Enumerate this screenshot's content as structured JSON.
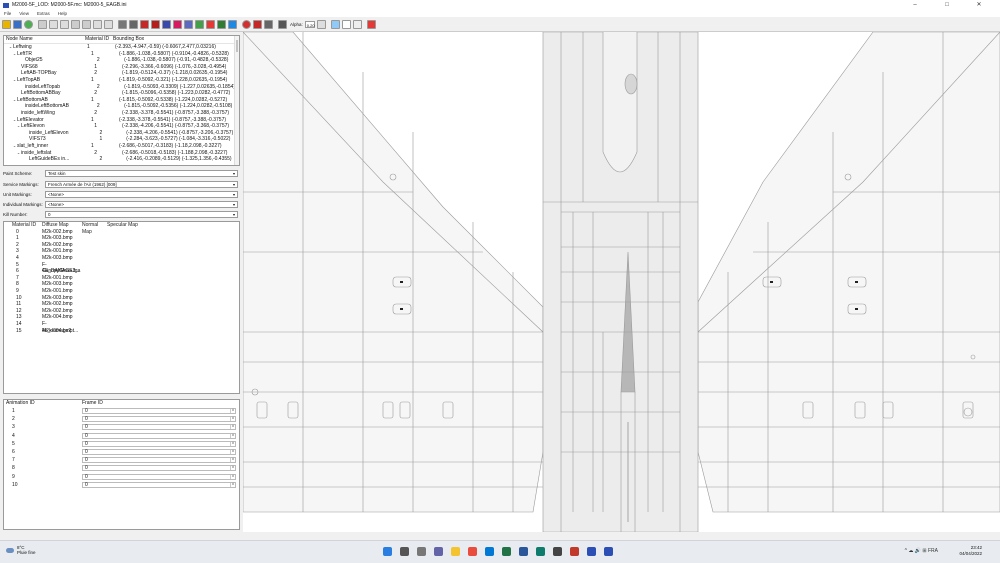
{
  "window": {
    "title": "M2000-5F_LOD: M2000-5F.mc: M2000-5_EAGB.ini",
    "minimize": "–",
    "maximize": "□",
    "close": "✕"
  },
  "menu": [
    "File",
    "View",
    "Extras",
    "Help"
  ],
  "toolbar": {
    "alpha_label": "Alpha:",
    "alpha_value": "0.20"
  },
  "tree": {
    "headers": [
      "Node Name",
      "Material ID",
      "Bounding Box"
    ],
    "rows": [
      {
        "name": "Leftwing",
        "indent": 1,
        "expand": "v",
        "mat": "1",
        "bb": "(-2.393,-4.947,-0.59) (-0.6067,2.477,0.03216)"
      },
      {
        "name": "LeftTR",
        "indent": 2,
        "expand": "v",
        "mat": "1",
        "bb": "(-1.886,-1.038,-0.5807) (-0.9104,-0.4826,-0.5328)"
      },
      {
        "name": "Objet25",
        "indent": 4,
        "expand": "",
        "mat": "2",
        "bb": "(-1.886,-1.038,-0.5807) (-0.91,-0.4828,-0.5328)"
      },
      {
        "name": "VIFS68",
        "indent": 3,
        "expand": "",
        "mat": "1",
        "bb": "(-2.296,-3.366,-0.6096) (-1.076,-3.028,-0.4954)"
      },
      {
        "name": "LeftAB-TOPBay",
        "indent": 3,
        "expand": "",
        "mat": "2",
        "bb": "(-1.819,-0.5124,-0.37) (-1.218,0.02635,-0.1954)"
      },
      {
        "name": "LeftTopAB",
        "indent": 2,
        "expand": "v",
        "mat": "1",
        "bb": "(-1.819,-0.5092,-0.321) (-1.228,0.02635,-0.1954)"
      },
      {
        "name": "insideLeftTopab",
        "indent": 4,
        "expand": "",
        "mat": "2",
        "bb": "(-1.819,-0.5093,-0.3309) (-1.227,0.02635,-0.1854)"
      },
      {
        "name": "LeftBottomABBay",
        "indent": 3,
        "expand": "",
        "mat": "2",
        "bb": "(-1.815,-0.5096,-0.5358) (-1.223,0.0282,-0.4772)"
      },
      {
        "name": "LeftBottomAB",
        "indent": 2,
        "expand": "v",
        "mat": "1",
        "bb": "(-1.815,-0.5092,-0.5338) (-1.224,0.0282,-0.5272)"
      },
      {
        "name": "insideLeftBottomAB",
        "indent": 4,
        "expand": "",
        "mat": "2",
        "bb": "(-1.815,-0.5092,-0.5356) (-1.224,0.0282,-0.5108)"
      },
      {
        "name": "inside_leftWing",
        "indent": 3,
        "expand": "",
        "mat": "2",
        "bb": "(-2.338,-3.378,-0.5541) (-0.8757,-3.388,-0.3757)"
      },
      {
        "name": "LeftElevator",
        "indent": 2,
        "expand": "v",
        "mat": "1",
        "bb": "(-2.338,-3.378,-0.5541) (-0.8757,-3.388,-0.3757)"
      },
      {
        "name": "LeftElevon",
        "indent": 3,
        "expand": "v",
        "mat": "1",
        "bb": "(-2.338,-4.206,-0.5541) (-0.8757,-3.368,-0.3757)"
      },
      {
        "name": "inside_LeftElevon",
        "indent": 5,
        "expand": "",
        "mat": "2",
        "bb": "(-2.338,-4.206,-0.5541) (-0.8757,-3.206,-0.3757)"
      },
      {
        "name": "VIFS73",
        "indent": 5,
        "expand": "",
        "mat": "1",
        "bb": "(-2.284,-3.623,-0.5727) (-1.084,-3.316,-0.5022)"
      },
      {
        "name": "slat_left_inner",
        "indent": 2,
        "expand": "v",
        "mat": "1",
        "bb": "(-2.686,-0.5017,-0.3183) (-1.18,2.098,-0.3227)"
      },
      {
        "name": "inside_leftslat",
        "indent": 3,
        "expand": "v",
        "mat": "2",
        "bb": "(-2.686,-0.5018,-0.5183) (-1.188,2.098,-0.3227)"
      },
      {
        "name": "LeftGuideBEs in...",
        "indent": 5,
        "expand": "",
        "mat": "2",
        "bb": "(-2.416,-0.2089,-0.5129) (-1.325,1.356,-0.4355)"
      }
    ]
  },
  "form": {
    "paint_scheme_label": "Paint Scheme:",
    "paint_scheme_value": "Test skin",
    "service_markings_label": "Service Markings:",
    "service_markings_value": "French Armée de l'Air (1962) [009]",
    "unit_markings_label": "Unit Markings:",
    "unit_markings_value": "<None>",
    "individual_markings_label": "Individual Markings:",
    "individual_markings_value": "<None>",
    "kill_number_label": "Kill Number:",
    "kill_number_value": "0"
  },
  "materials": {
    "headers": [
      "Material ID",
      "Diffuse Map",
      "Normal Map",
      "Specular Map"
    ],
    "rows": [
      {
        "id": "0",
        "diffuse": "M2k-002.bmp"
      },
      {
        "id": "1",
        "diffuse": "M2k-003.bmp"
      },
      {
        "id": "2",
        "diffuse": "M2k-002.bmp"
      },
      {
        "id": "3",
        "diffuse": "M2k-001.bmp"
      },
      {
        "id": "4",
        "diffuse": "M2k-003.bmp"
      },
      {
        "id": "5",
        "diffuse": "F-4E_DAMAGE3..."
      },
      {
        "id": "6",
        "diffuse": "CanopyGlass.tga"
      },
      {
        "id": "7",
        "diffuse": "M2k-001.bmp"
      },
      {
        "id": "8",
        "diffuse": "M2k-003.bmp"
      },
      {
        "id": "9",
        "diffuse": "M2k-001.bmp"
      },
      {
        "id": "10",
        "diffuse": "M2k-003.bmp"
      },
      {
        "id": "11",
        "diffuse": "M2k-002.bmp"
      },
      {
        "id": "12",
        "diffuse": "M2k-002.bmp"
      },
      {
        "id": "13",
        "diffuse": "M2k-004.bmp"
      },
      {
        "id": "14",
        "diffuse": "F-4e_damage2.t..."
      },
      {
        "id": "15",
        "diffuse": "M2k-004.bmp"
      }
    ]
  },
  "animation": {
    "headers": [
      "Animation ID",
      "Frame ID"
    ],
    "rows": [
      {
        "id": "1",
        "frame": "0"
      },
      {
        "id": "2",
        "frame": "0"
      },
      {
        "id": "3",
        "frame": "0"
      },
      {
        "id": "4",
        "frame": "0"
      },
      {
        "id": "5",
        "frame": "0"
      },
      {
        "id": "6",
        "frame": "0"
      },
      {
        "id": "7",
        "frame": "0"
      },
      {
        "id": "8",
        "frame": "0"
      },
      {
        "id": "9",
        "frame": "0"
      },
      {
        "id": "10",
        "frame": "0"
      }
    ]
  },
  "taskbar": {
    "temperature": "8°C",
    "weather": "Pluie fine",
    "time": "23:42",
    "date": "04/04/2022",
    "tray": "^ ☁ 🔊 ⊞ FRA"
  },
  "colors": {
    "accent": "#2b4fb5",
    "panel_bg": "#f0f0f0",
    "viewport_bg": "#ffffff",
    "taskbar_bg": "#e8ecf0"
  }
}
